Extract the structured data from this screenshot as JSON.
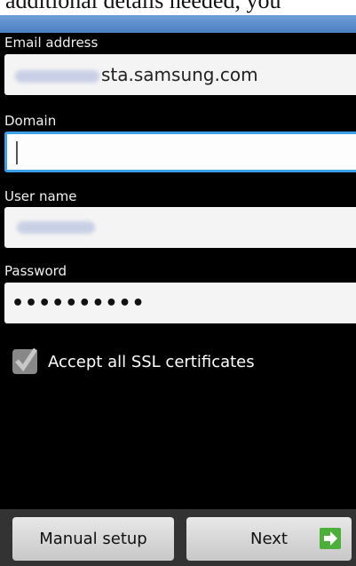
{
  "doc_caption": "additional details needed, you",
  "fields": {
    "email": {
      "label": "Email address",
      "value_suffix": "sta.samsung.com"
    },
    "domain": {
      "label": "Domain",
      "value": ""
    },
    "username": {
      "label": "User name"
    },
    "password": {
      "label": "Password",
      "value": "••••••••••"
    }
  },
  "ssl": {
    "label": "Accept all SSL certificates",
    "checked": true
  },
  "buttons": {
    "manual": "Manual setup",
    "next": "Next"
  },
  "icons": {
    "next": "arrow-right-icon",
    "check": "checkmark-icon"
  },
  "colors": {
    "focus": "#3aa0e8",
    "next_icon": "#4caf3a"
  }
}
